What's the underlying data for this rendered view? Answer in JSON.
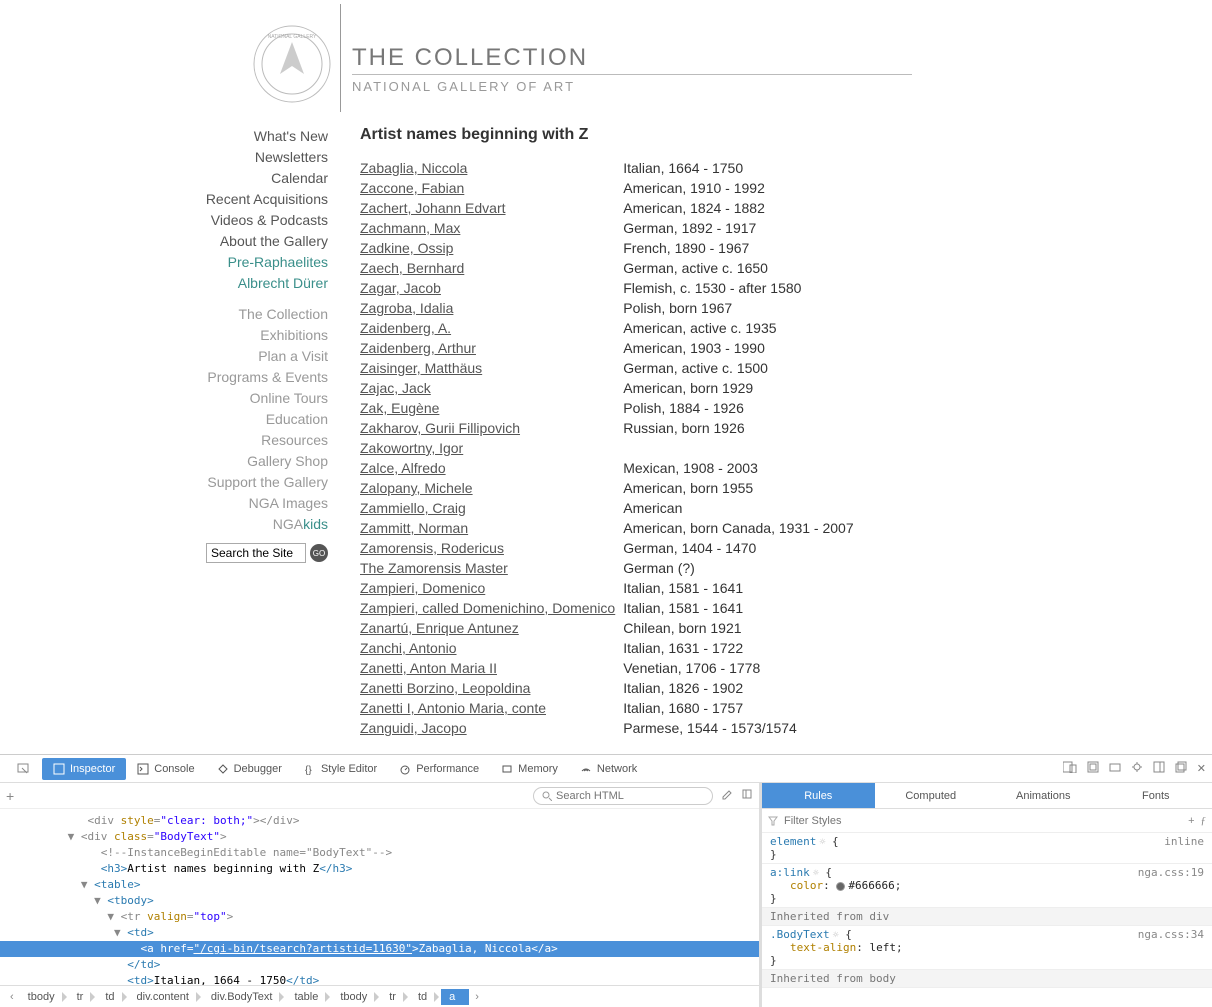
{
  "header": {
    "title": "THE COLLECTION",
    "subtitle": "NATIONAL GALLERY OF ART"
  },
  "sidebar": {
    "primary": [
      "What's New",
      "Newsletters",
      "Calendar",
      "Recent Acquisitions",
      "Videos & Podcasts",
      "About the Gallery"
    ],
    "teal": [
      "Pre-Raphaelites",
      "Albrecht Dürer"
    ],
    "secondary": [
      "The Collection",
      "Exhibitions",
      "Plan a Visit",
      "Programs & Events",
      "Online Tours",
      "Education",
      "Resources",
      "Gallery Shop",
      "Support the Gallery",
      "NGA Images"
    ],
    "ngakids_prefix": "NGA",
    "ngakids_suffix": "kids",
    "search_placeholder": "Search the Site",
    "go_label": "GO"
  },
  "content": {
    "heading": "Artist names beginning with Z",
    "artists": [
      {
        "name": "Zabaglia, Niccola",
        "info": "Italian, 1664 - 1750"
      },
      {
        "name": "Zaccone, Fabian",
        "info": "American, 1910 - 1992"
      },
      {
        "name": "Zachert, Johann Edvart",
        "info": "American, 1824 - 1882"
      },
      {
        "name": "Zachmann, Max",
        "info": "German, 1892 - 1917"
      },
      {
        "name": "Zadkine, Ossip",
        "info": "French, 1890 - 1967"
      },
      {
        "name": "Zaech, Bernhard",
        "info": "German, active c. 1650"
      },
      {
        "name": "Zagar, Jacob",
        "info": "Flemish, c. 1530 - after 1580"
      },
      {
        "name": "Zagroba, Idalia",
        "info": "Polish, born 1967"
      },
      {
        "name": "Zaidenberg, A.",
        "info": "American, active c. 1935"
      },
      {
        "name": "Zaidenberg, Arthur",
        "info": "American, 1903 - 1990"
      },
      {
        "name": "Zaisinger, Matthäus",
        "info": "German, active c. 1500"
      },
      {
        "name": "Zajac, Jack",
        "info": "American, born 1929"
      },
      {
        "name": "Zak, Eugène",
        "info": "Polish, 1884 - 1926"
      },
      {
        "name": "Zakharov, Gurii Fillipovich",
        "info": "Russian, born 1926"
      },
      {
        "name": "Zakowortny, Igor",
        "info": ""
      },
      {
        "name": "Zalce, Alfredo",
        "info": "Mexican, 1908 - 2003"
      },
      {
        "name": "Zalopany, Michele",
        "info": "American, born 1955"
      },
      {
        "name": "Zammiello, Craig",
        "info": "American"
      },
      {
        "name": "Zammitt, Norman",
        "info": "American, born Canada, 1931 - 2007"
      },
      {
        "name": "Zamorensis, Rodericus",
        "info": "German, 1404 - 1470"
      },
      {
        "name": "The Zamorensis Master",
        "info": "German (?)"
      },
      {
        "name": "Zampieri, Domenico",
        "info": "Italian, 1581 - 1641"
      },
      {
        "name": "Zampieri, called Domenichino, Domenico",
        "info": "Italian, 1581 - 1641"
      },
      {
        "name": "Zanartú, Enrique Antunez",
        "info": "Chilean, born 1921"
      },
      {
        "name": "Zanchi, Antonio",
        "info": "Italian, 1631 - 1722"
      },
      {
        "name": "Zanetti, Anton Maria II",
        "info": "Venetian, 1706 - 1778"
      },
      {
        "name": "Zanetti Borzino, Leopoldina",
        "info": "Italian, 1826 - 1902"
      },
      {
        "name": "Zanetti I, Antonio Maria, conte",
        "info": "Italian, 1680 - 1757"
      },
      {
        "name": "Zanguidi, Jacopo",
        "info": "Parmese, 1544 - 1573/1574"
      }
    ]
  },
  "devtools": {
    "tabs": [
      "Inspector",
      "Console",
      "Debugger",
      "Style Editor",
      "Performance",
      "Memory",
      "Network"
    ],
    "search_placeholder": "Search HTML",
    "markup": {
      "l1_pre": "<div ",
      "l1_attr1": "style",
      "l1_val1": "\"clear: both;\"",
      "l1_post": "></div>",
      "l2_pre": "<div ",
      "l2_attr": "class",
      "l2_val": "\"BodyText\"",
      "l2_post": ">",
      "l3": "<!--InstanceBeginEditable name=\"BodyText\"-->",
      "l4_open": "<h3>",
      "l4_text": "Artist names beginning with Z",
      "l4_close": "</h3>",
      "l5": "<table>",
      "l6": "<tbody>",
      "l7_pre": "<tr ",
      "l7_attr": "valign",
      "l7_val": "\"top\"",
      "l7_post": ">",
      "l8": "<td>",
      "l9_pre": "<a ",
      "l9_attr": "href",
      "l9_val": "\"/cgi-bin/tsearch?artistid=11630\"",
      "l9_post": ">Zabaglia, Niccola</a>",
      "l10": "</td>",
      "l11_open": "<td>",
      "l11_text": "Italian, 1664 - 1750",
      "l11_close": "</td>"
    },
    "breadcrumbs": [
      "tbody",
      "tr",
      "td",
      "div.content",
      "div.BodyText",
      "table",
      "tbody",
      "tr",
      "td",
      "a"
    ],
    "right_tabs": [
      "Rules",
      "Computed",
      "Animations",
      "Fonts"
    ],
    "filter_placeholder": "Filter Styles",
    "rules": {
      "r1_sel": "element",
      "r1_src": "inline",
      "r2_sel": "a:link",
      "r2_src": "nga.css:19",
      "r2_prop": "color",
      "r2_val": "#666666",
      "inh1": "Inherited from div",
      "r3_sel": ".BodyText",
      "r3_src": "nga.css:34",
      "r3_prop": "text-align",
      "r3_val": "left",
      "inh2": "Inherited from body"
    }
  }
}
